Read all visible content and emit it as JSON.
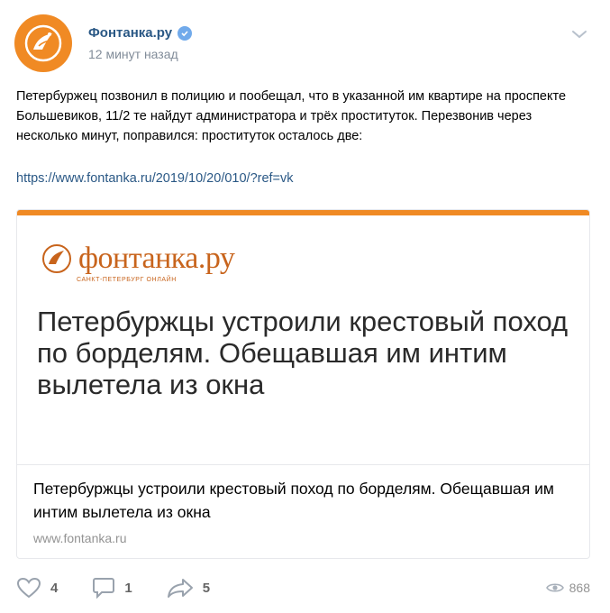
{
  "post": {
    "author": "Фонтанка.ру",
    "time": "12 минут назад",
    "text": "Петербуржец позвонил в полицию и пообещал, что в указанной им квартире на проспекте Большевиков, 11/2 те найдут администратора и трёх проституток. Перезвонив через несколько минут, поправился: проституток осталось две:",
    "link": "https://www.fontanka.ru/2019/10/20/010/?ref=vk"
  },
  "card": {
    "brand_name": "фонтанка.ру",
    "brand_sub": "САНКТ-ПЕТЕРБУРГ ОНЛАЙН",
    "image_headline": "Петербуржцы устроили крестовый поход по борделям. Обещавшая им интим вылетела из окна",
    "title": "Петербуржцы устроили крестовый поход по борделям. Обещавшая им интим вылетела из окна",
    "domain": "www.fontanka.ru"
  },
  "actions": {
    "likes": "4",
    "comments": "1",
    "shares": "5",
    "views": "868"
  },
  "colors": {
    "brand_orange": "#f08a24",
    "link_blue": "#2a5885",
    "icon_gray": "#99a2ad"
  }
}
